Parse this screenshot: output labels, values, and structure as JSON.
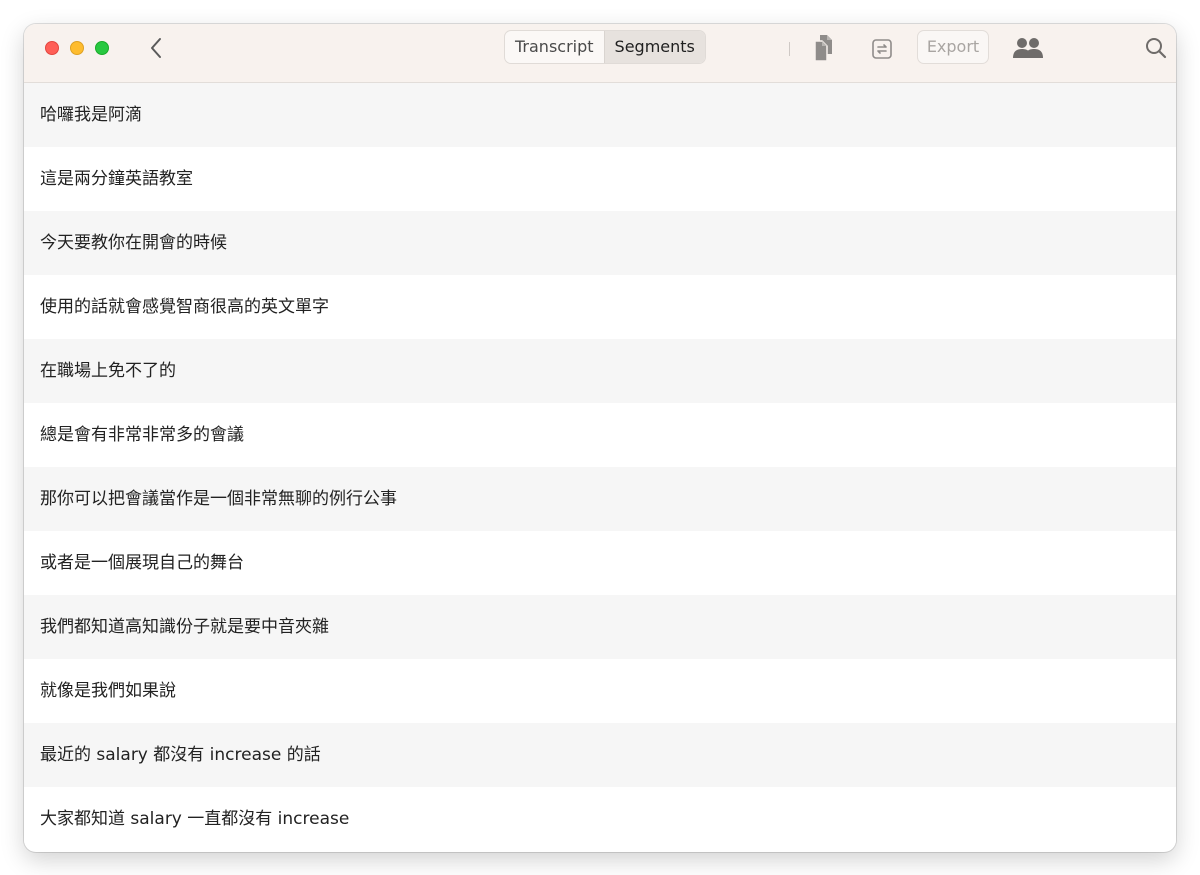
{
  "window": {
    "controls": [
      "close",
      "minimize",
      "zoom"
    ]
  },
  "toolbar": {
    "back_icon": "chevron-left-icon",
    "tabs": [
      {
        "label": "Transcript",
        "active": false
      },
      {
        "label": "Segments",
        "active": true
      }
    ],
    "copy_icon": "copy-documents-icon",
    "convert_icon": "swap-box-icon",
    "export_label": "Export",
    "speakers_icon": "people-icon",
    "search_icon": "search-icon"
  },
  "segments": [
    "哈囉我是阿滴",
    "這是兩分鐘英語教室",
    "今天要教你在開會的時候",
    "使用的話就會感覺智商很高的英文單字",
    "在職場上免不了的",
    "總是會有非常非常多的會議",
    "那你可以把會議當作是一個非常無聊的例行公事",
    "或者是一個展現自己的舞台",
    "我們都知道高知識份子就是要中音夾雜",
    "就像是我們如果說",
    "最近的 salary 都沒有 increase 的話",
    "大家都知道 salary 一直都沒有 increase"
  ],
  "colors": {
    "titlebar_bg": "#f8f2ee",
    "row_alt_bg": "#f6f6f6",
    "text": "#222222",
    "close": "#ff5f57",
    "minimize": "#febc2e",
    "zoom": "#28c840"
  }
}
